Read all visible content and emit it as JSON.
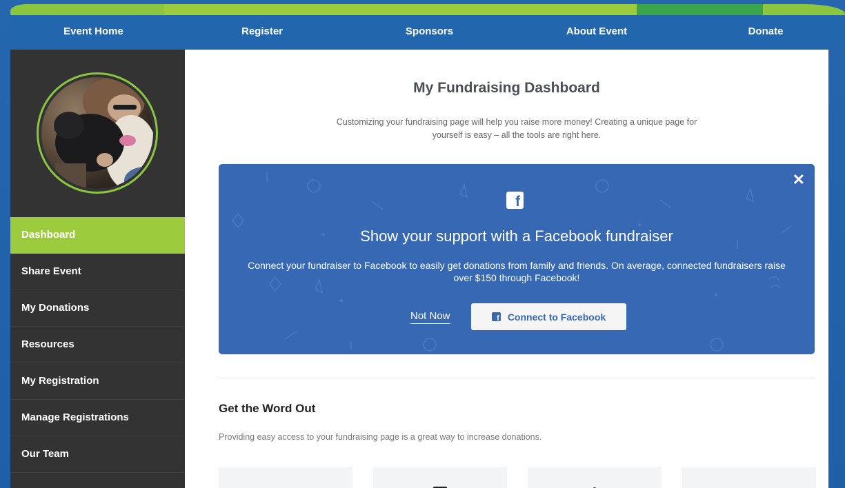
{
  "topnav": {
    "items": [
      {
        "label": "Event Home"
      },
      {
        "label": "Register"
      },
      {
        "label": "Sponsors"
      },
      {
        "label": "About Event"
      },
      {
        "label": "Donate"
      }
    ]
  },
  "sidebar": {
    "menu": [
      {
        "label": "Dashboard",
        "active": true
      },
      {
        "label": "Share Event"
      },
      {
        "label": "My Donations"
      },
      {
        "label": "Resources"
      },
      {
        "label": "My Registration"
      },
      {
        "label": "Manage Registrations"
      },
      {
        "label": "Our Team"
      }
    ]
  },
  "main": {
    "title": "My Fundraising Dashboard",
    "intro": "Customizing your fundraising page will help you raise more money! Creating a unique page for yourself is easy – all the tools are right here.",
    "facebook_promo": {
      "icon": "facebook-icon",
      "close_label": "✕",
      "title": "Show your support with a Facebook fundraiser",
      "body": "Connect your fundraiser to Facebook to easily get donations from family and friends. On average, connected fundraisers raise over $150 through Facebook!",
      "not_now_label": "Not Now",
      "connect_label": "Connect to Facebook"
    },
    "word_out": {
      "title": "Get the Word Out",
      "subtitle": "Providing easy access to your fundraising page is a great way to increase donations."
    }
  },
  "colors": {
    "brand_blue": "#2266ae",
    "sidebar_bg": "#333333",
    "active_green": "#9ccc3e",
    "facebook_blue": "#3668b3"
  }
}
